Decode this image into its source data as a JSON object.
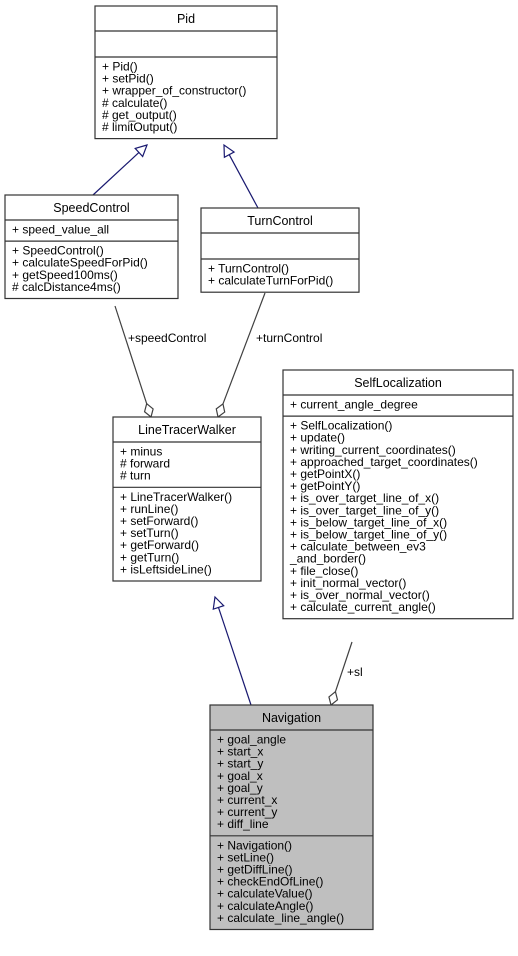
{
  "diagram": {
    "type": "uml-class-collaboration",
    "classes": [
      {
        "id": "pid",
        "name": "Pid",
        "attributes": [],
        "methods": [
          "+ Pid()",
          "+ setPid()",
          "+ wrapper_of_constructor()",
          "# calculate()",
          "# get_output()",
          "# limitOutput()"
        ],
        "highlighted": false
      },
      {
        "id": "speedcontrol",
        "name": "SpeedControl",
        "attributes": [
          "+ speed_value_all"
        ],
        "methods": [
          "+ SpeedControl()",
          "+ calculateSpeedForPid()",
          "+ getSpeed100ms()",
          "# calcDistance4ms()"
        ],
        "highlighted": false
      },
      {
        "id": "turncontrol",
        "name": "TurnControl",
        "attributes": [],
        "methods": [
          "+ TurnControl()",
          "+ calculateTurnForPid()"
        ],
        "highlighted": false
      },
      {
        "id": "linetracerwalker",
        "name": "LineTracerWalker",
        "attributes": [
          "+ minus",
          "# forward",
          "# turn"
        ],
        "methods": [
          "+ LineTracerWalker()",
          "+ runLine()",
          "+ setForward()",
          "+ setTurn()",
          "+ getForward()",
          "+ getTurn()",
          "+ isLeftsideLine()"
        ],
        "highlighted": false
      },
      {
        "id": "selflocalization",
        "name": "SelfLocalization",
        "attributes": [
          "+ current_angle_degree"
        ],
        "methods": [
          "+ SelfLocalization()",
          "+ update()",
          "+ writing_current_coordinates()",
          "+ approached_target_coordinates()",
          "+ getPointX()",
          "+ getPointY()",
          "+ is_over_target_line_of_x()",
          "+ is_over_target_line_of_y()",
          "+ is_below_target_line_of_x()",
          "+ is_below_target_line_of_y()",
          "+ calculate_between_ev3",
          "_and_border()",
          "+ file_close()",
          "+ init_normal_vector()",
          "+ is_over_normal_vector()",
          "+ calculate_current_angle()"
        ],
        "highlighted": false
      },
      {
        "id": "navigation",
        "name": "Navigation",
        "attributes": [
          "+ goal_angle",
          "+ start_x",
          "+ start_y",
          "+ goal_x",
          "+ goal_y",
          "+ current_x",
          "+ current_y",
          "+ diff_line"
        ],
        "methods": [
          "+ Navigation()",
          "+ setLine()",
          "+ getDiffLine()",
          "+ checkEndOfLine()",
          "+ calculateValue()",
          "+ calculateAngle()",
          "+ calculate_line_angle()"
        ],
        "highlighted": true
      }
    ],
    "relations": [
      {
        "type": "inheritance",
        "from": "speedcontrol",
        "to": "pid",
        "label": ""
      },
      {
        "type": "inheritance",
        "from": "turncontrol",
        "to": "pid",
        "label": ""
      },
      {
        "type": "inheritance",
        "from": "navigation",
        "to": "linetracerwalker",
        "label": ""
      },
      {
        "type": "aggregation",
        "from": "speedcontrol",
        "to": "linetracerwalker",
        "label": "+speedControl"
      },
      {
        "type": "aggregation",
        "from": "turncontrol",
        "to": "linetracerwalker",
        "label": "+turnControl"
      },
      {
        "type": "aggregation",
        "from": "selflocalization",
        "to": "navigation",
        "label": "+sl"
      }
    ],
    "colors": {
      "inheritance_edge": "#191970",
      "aggregation_edge": "#404040",
      "highlight_fill": "#bfbfbf",
      "box_border": "#333333"
    }
  }
}
